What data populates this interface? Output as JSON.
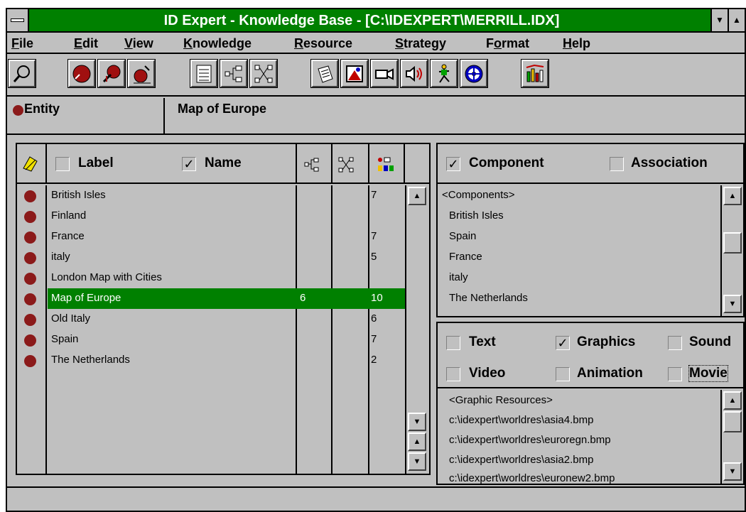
{
  "window": {
    "title": "ID Expert - Knowledge Base - [C:\\IDEXPERT\\MERRILL.IDX]",
    "min_glyph": "▼",
    "max_glyph": "▲"
  },
  "menu": {
    "file": {
      "ul": "F",
      "rest": "ile"
    },
    "edit": {
      "ul": "E",
      "rest": "dit"
    },
    "view": {
      "ul": "V",
      "rest": "iew"
    },
    "knowledge": {
      "ul": "K",
      "rest": "nowledge"
    },
    "resource": {
      "ul": "R",
      "rest": "esource"
    },
    "strategy": {
      "ul": "S",
      "rest": "trategy"
    },
    "format": {
      "pre": "F",
      "ul": "o",
      "rest": "rmat"
    },
    "help": {
      "ul": "H",
      "rest": "elp"
    }
  },
  "toolbar": {
    "icons": [
      "magnifier-icon",
      "entity-icon",
      "entity-edit-icon",
      "entity-new-icon",
      "list-view-icon",
      "tree-view-icon",
      "network-view-icon",
      "document-icon",
      "graphics-icon",
      "video-icon",
      "sound-icon",
      "animation-icon",
      "movie-icon",
      "chart-icon"
    ]
  },
  "entity_bar": {
    "type_label": "Entity",
    "current_name": "Map of Europe"
  },
  "entity_list": {
    "headers": {
      "label": "Label",
      "name": "Name",
      "name_checked_glyph": "✓",
      "label_checked": false,
      "name_checked": true
    },
    "rows": [
      {
        "name": "British Isles",
        "c1": "",
        "c2": "",
        "c3": "7"
      },
      {
        "name": "Finland",
        "c1": "",
        "c2": "",
        "c3": ""
      },
      {
        "name": "France",
        "c1": "",
        "c2": "",
        "c3": "7"
      },
      {
        "name": "italy",
        "c1": "",
        "c2": "",
        "c3": "5"
      },
      {
        "name": "London Map with Cities",
        "c1": "",
        "c2": "",
        "c3": ""
      },
      {
        "name": "Map of Europe",
        "c1": "6",
        "c2": "",
        "c3": "10",
        "selected": true
      },
      {
        "name": "Old Italy",
        "c1": "",
        "c2": "",
        "c3": "6"
      },
      {
        "name": "Spain",
        "c1": "",
        "c2": "",
        "c3": "7"
      },
      {
        "name": "The Netherlands",
        "c1": "",
        "c2": "",
        "c3": "2"
      }
    ]
  },
  "components": {
    "component_label": "Component",
    "association_label": "Association",
    "component_checked": true,
    "association_checked": false,
    "items": [
      "<Components>",
      "British Isles",
      "Spain",
      "France",
      "italy",
      "The Netherlands"
    ]
  },
  "resources": {
    "types": {
      "text": "Text",
      "graphics": "Graphics",
      "sound": "Sound",
      "video": "Video",
      "animation": "Animation",
      "movie": "Movie"
    },
    "checked": {
      "text": false,
      "graphics": true,
      "sound": false,
      "video": false,
      "animation": false,
      "movie": false
    },
    "items": [
      "<Graphic Resources>",
      "c:\\idexpert\\worldres\\asia4.bmp",
      "c:\\idexpert\\worldres\\euroregn.bmp",
      "c:\\idexpert\\worldres\\asia2.bmp",
      "c:\\idexpert\\worldres\\euronew2.bmp"
    ]
  },
  "glyphs": {
    "check": "✓",
    "up": "▲",
    "down": "▼",
    "page_up": "▲",
    "page_down": "▼"
  },
  "colors": {
    "title_green": "#008000",
    "selection_green": "#008000",
    "entity_red": "#8b1a1a",
    "face_gray": "#c0c0c0"
  }
}
